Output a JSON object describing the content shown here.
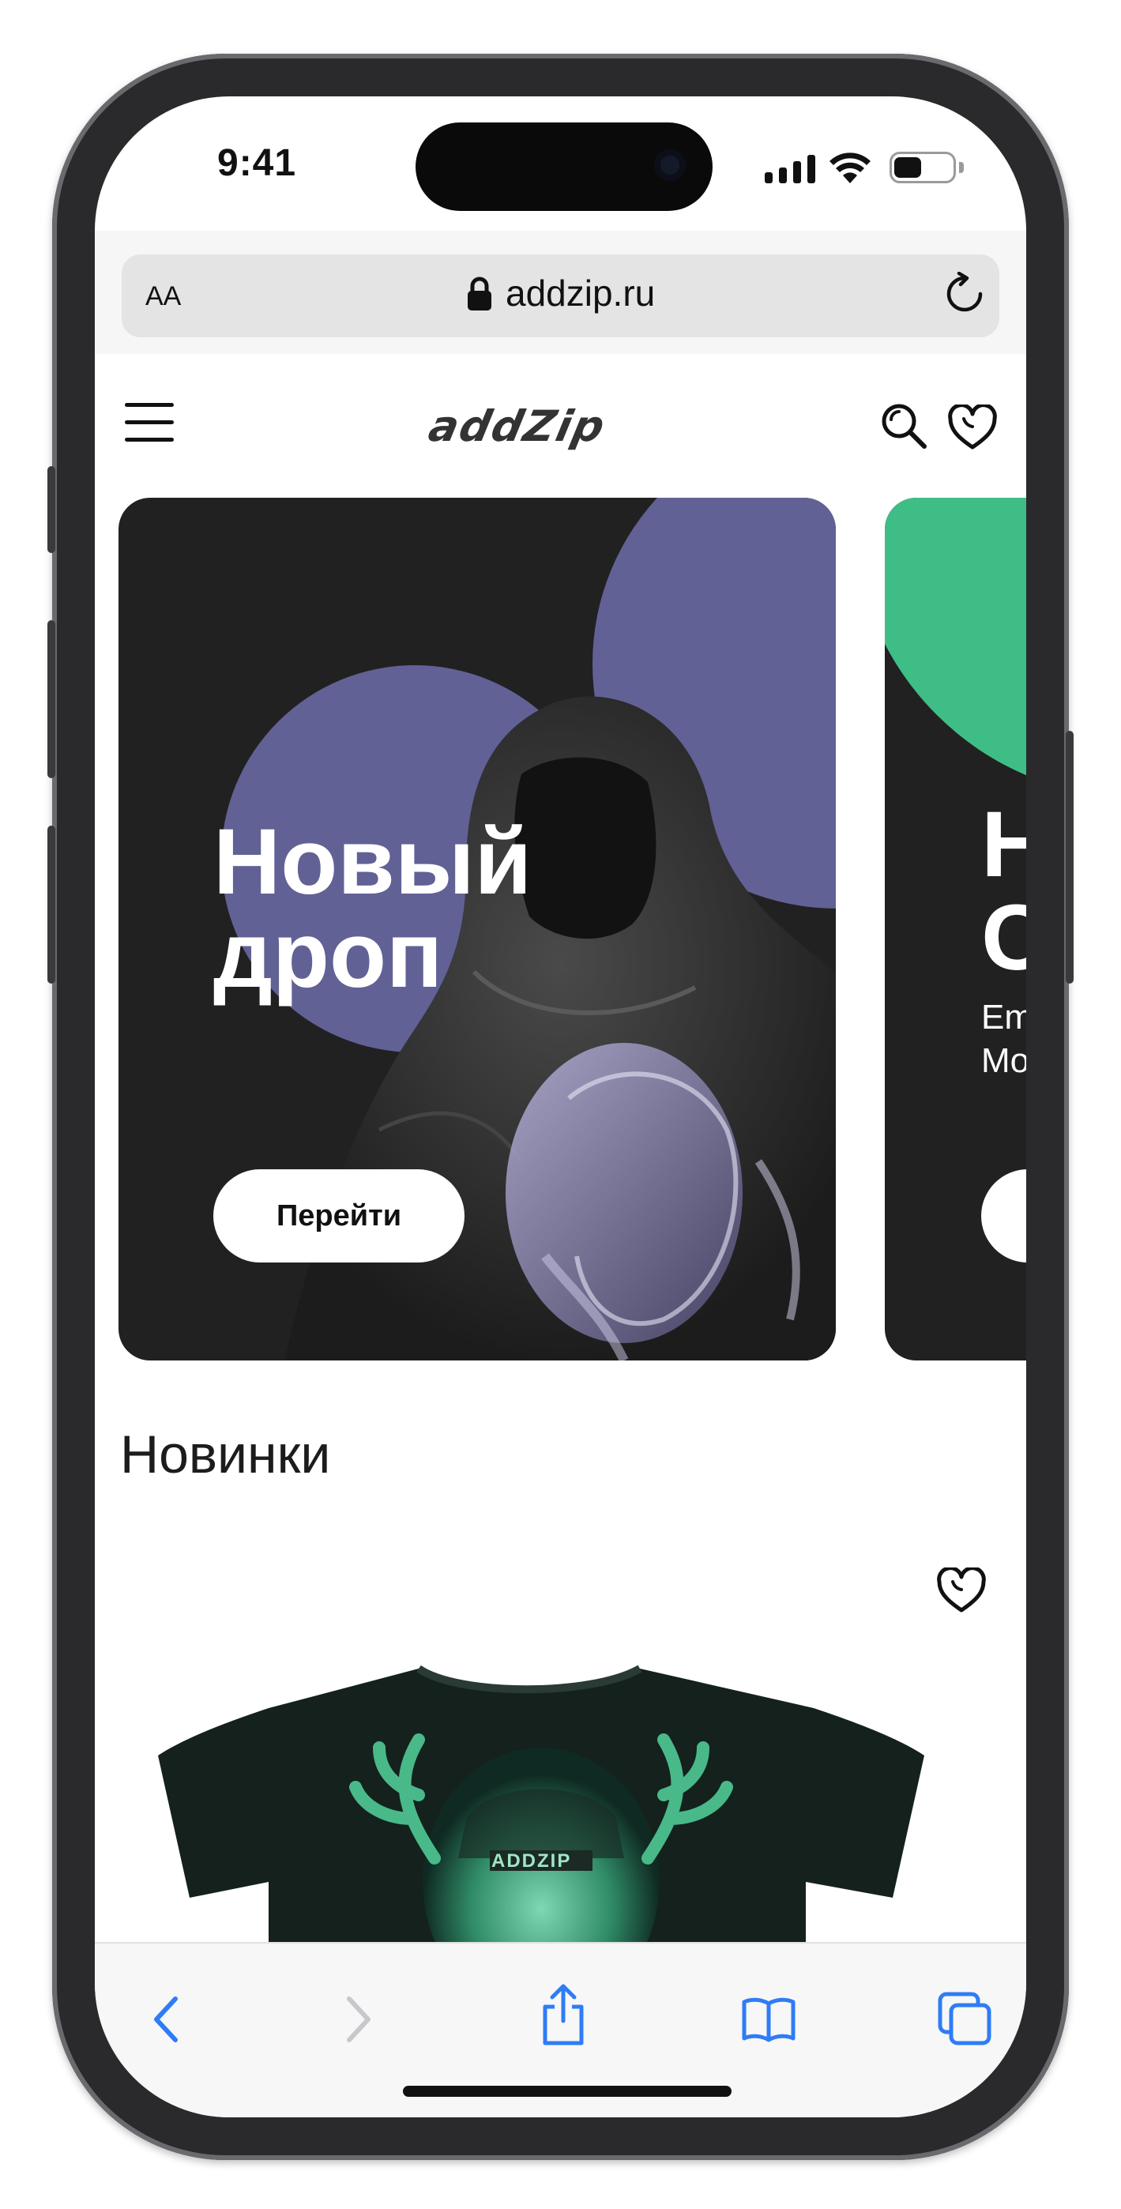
{
  "status_bar": {
    "time": "9:41"
  },
  "browser": {
    "text_size_label": "AA",
    "url": "addzip.ru"
  },
  "site": {
    "logo": "addZip",
    "banners": [
      {
        "title_line1": "Новый",
        "title_line2": "дроп",
        "button": "Перейти",
        "colors": {
          "bg": "#212121",
          "accent": "#626196"
        }
      },
      {
        "title_line1": "Н",
        "title_line2": "С",
        "subtitle_line1": "Em",
        "subtitle_line2": "Mo",
        "colors": {
          "bg": "#212121",
          "accent": "#3ebe86"
        }
      }
    ],
    "section_title": "Новинки",
    "product": {
      "print_text": "ADDZIP"
    }
  },
  "icons": [
    "menu-icon",
    "search-icon",
    "heart-icon",
    "lock-icon",
    "reload-icon",
    "back-icon",
    "forward-icon",
    "share-icon",
    "bookmarks-icon",
    "tabs-icon"
  ],
  "colors": {
    "ios_blue": "#2f7cf6",
    "disabled": "#c7c7cc"
  }
}
